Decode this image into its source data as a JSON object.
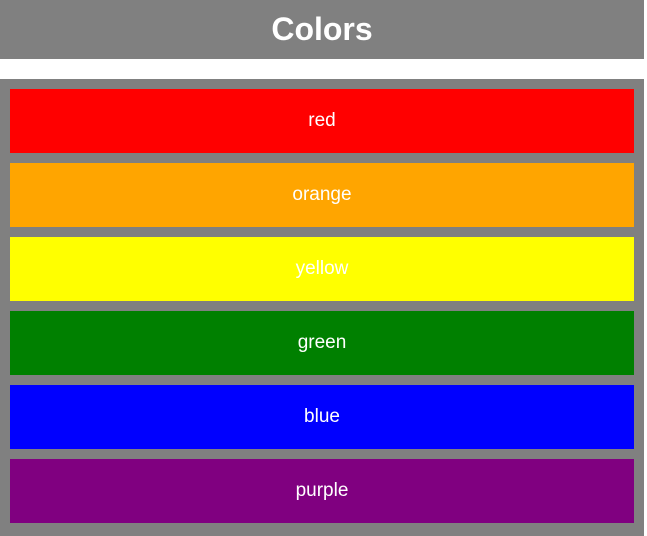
{
  "header": {
    "title": "Colors",
    "background": "#808080"
  },
  "colors": [
    {
      "label": "red",
      "hex": "#ff0000"
    },
    {
      "label": "orange",
      "hex": "#ffa500"
    },
    {
      "label": "yellow",
      "hex": "#ffff00"
    },
    {
      "label": "green",
      "hex": "#008000"
    },
    {
      "label": "blue",
      "hex": "#0000ff"
    },
    {
      "label": "purple",
      "hex": "#800080"
    }
  ]
}
